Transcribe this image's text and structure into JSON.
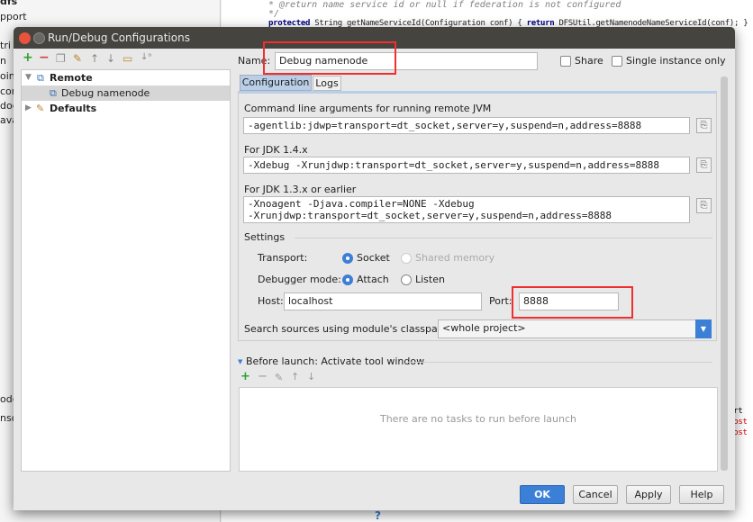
{
  "ide": {
    "left_items": [
      "dfs",
      "pport",
      "tri",
      "n",
      "oin",
      "con",
      "doc",
      "ava",
      "ode",
      "nso"
    ],
    "code_lines": [
      {
        "comment": "* @return name service id or null if federation is not configured"
      },
      {
        "comment": "*/"
      },
      {
        "kw": "protected",
        "text": " String getNameServiceId(Configuration conf) { ",
        "kw2": "return",
        "text2": " DFSUtil.getNamenodeNameServiceId(conf); }"
      }
    ],
    "right_log": [
      "port",
      ".host",
      ".host"
    ],
    "help_icon": "?"
  },
  "dialog": {
    "title": "Run/Debug Configurations",
    "toolbar": [
      "add-icon",
      "remove-icon",
      "copy-icon",
      "edit-defaults-icon",
      "move-up-icon",
      "move-down-icon",
      "folder-icon",
      "sort-icon"
    ],
    "tree": [
      {
        "label": "Remote",
        "expanded": true,
        "bold": true
      },
      {
        "label": "Debug namenode",
        "selected": true
      },
      {
        "label": "Defaults",
        "expanded": false,
        "bold": true
      }
    ],
    "name_label": "Name:",
    "name_value": "Debug namenode",
    "share_label": "Share",
    "share_checked": false,
    "single_instance_label": "Single instance only",
    "single_instance_checked": false,
    "tabs": [
      "Configuration",
      "Logs"
    ],
    "active_tab": "Configuration",
    "cmd_label": "Command line arguments for running remote JVM",
    "cmd_value": "-agentlib:jdwp=transport=dt_socket,server=y,suspend=n,address=8888",
    "jdk14_label": "For JDK 1.4.x",
    "jdk14_value": "-Xdebug -Xrunjdwp:transport=dt_socket,server=y,suspend=n,address=8888",
    "jdk13_label": "For JDK 1.3.x or earlier",
    "jdk13_line1": "-Xnoagent -Djava.compiler=NONE -Xdebug",
    "jdk13_line2": "-Xrunjdwp:transport=dt_socket,server=y,suspend=n,address=8888",
    "settings_label": "Settings",
    "transport_label": "Transport:",
    "transport_options": [
      "Socket",
      "Shared memory"
    ],
    "transport_selected": "Socket",
    "mode_label": "Debugger mode:",
    "mode_options": [
      "Attach",
      "Listen"
    ],
    "mode_selected": "Attach",
    "host_label": "Host:",
    "host_value": "localhost",
    "port_label": "Port:",
    "port_value": "8888",
    "classpath_label": "Search sources using module's classpath:",
    "classpath_value": "<whole project>",
    "before_launch_label": "Before launch: Activate tool window",
    "before_launch_toolbar": [
      "add-icon",
      "remove-icon",
      "edit-icon",
      "move-up-icon",
      "move-down-icon"
    ],
    "no_tasks": "There are no tasks to run before launch",
    "buttons": {
      "ok": "OK",
      "cancel": "Cancel",
      "apply": "Apply",
      "help": "Help"
    },
    "accent": "#3b7fd6",
    "highlight": "#f03030"
  }
}
